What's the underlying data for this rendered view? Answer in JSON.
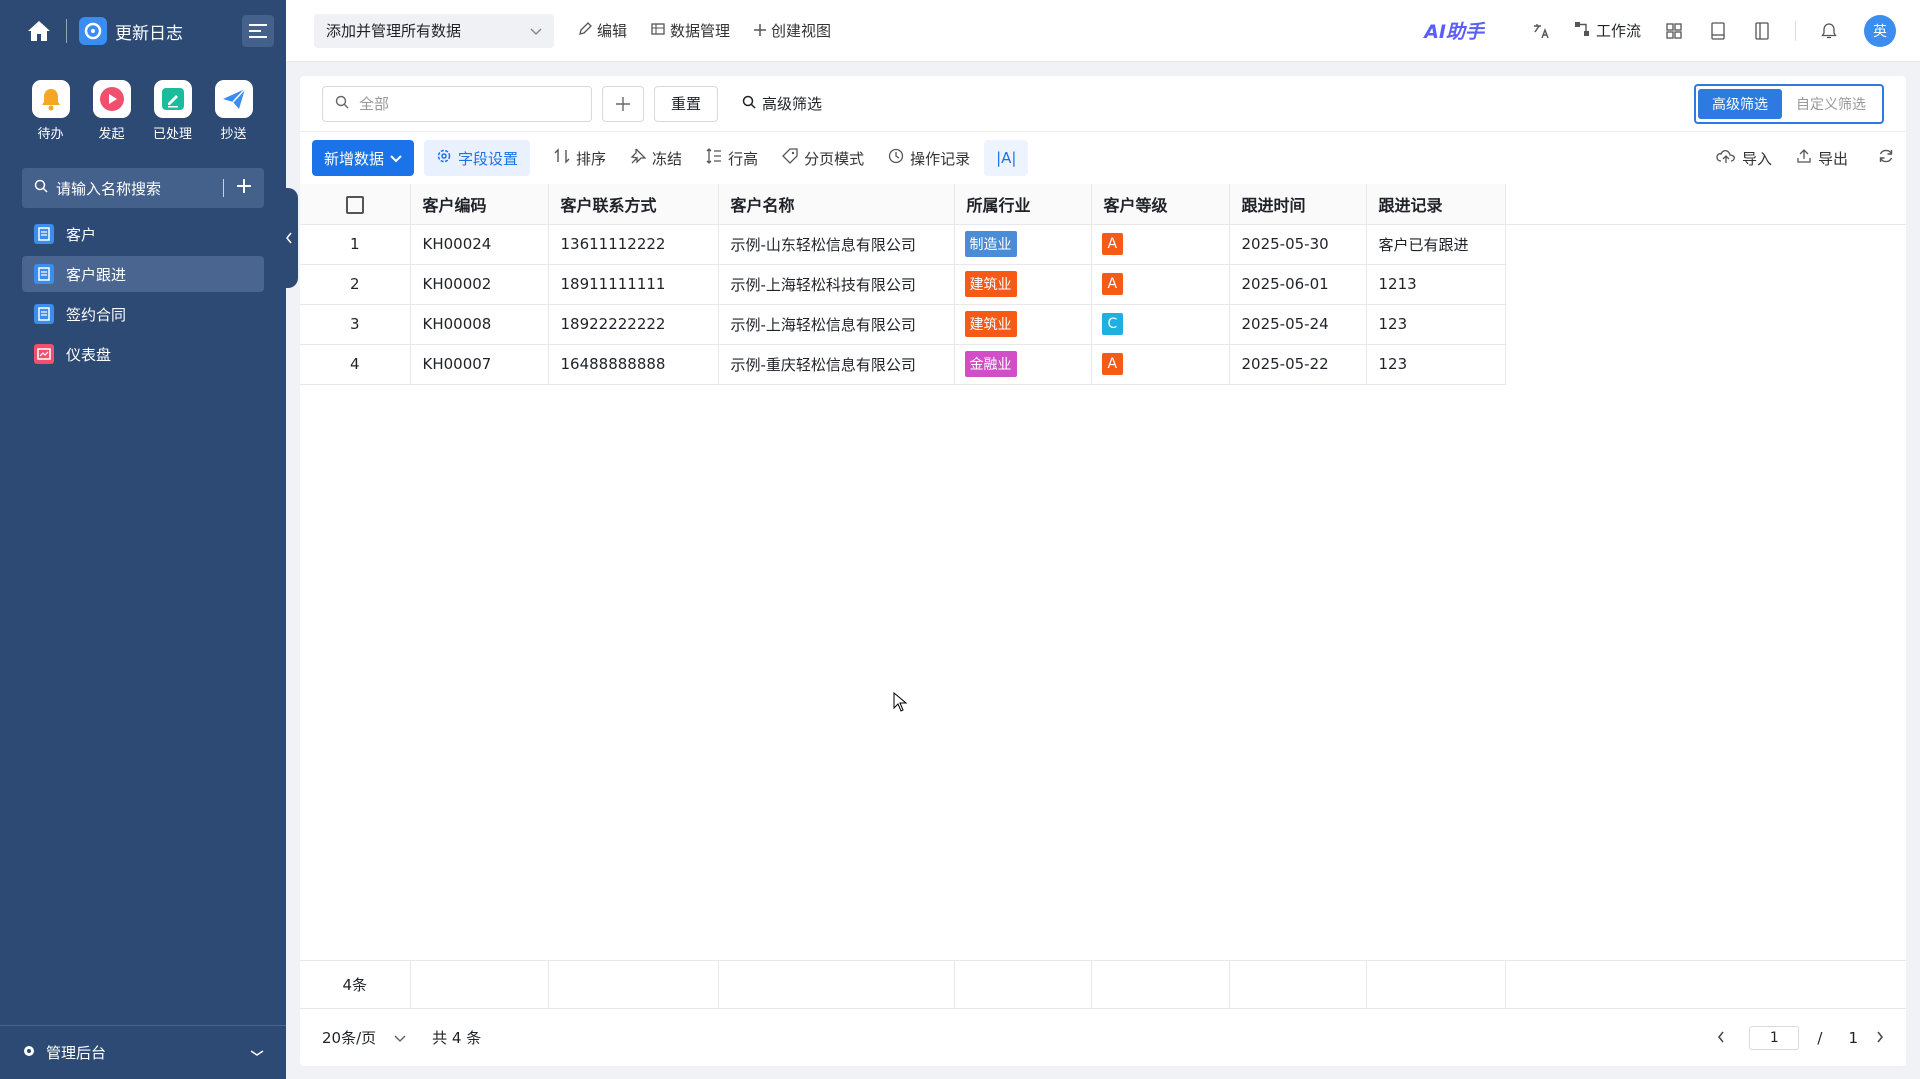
{
  "app": {
    "name": "更新日志"
  },
  "quick": [
    {
      "label": "待办",
      "icon": "bell-icon",
      "color": "#f5a623"
    },
    {
      "label": "发起",
      "icon": "play-icon",
      "color": "#f0506e"
    },
    {
      "label": "已处理",
      "icon": "check-doc-icon",
      "color": "#1abc9c"
    },
    {
      "label": "抄送",
      "icon": "send-icon",
      "color": "#3b8df0"
    }
  ],
  "sidebar": {
    "search_placeholder": "请输入名称搜索",
    "items": [
      {
        "label": "客户",
        "active": false
      },
      {
        "label": "客户跟进",
        "active": true
      },
      {
        "label": "签约合同",
        "active": false
      },
      {
        "label": "仪表盘",
        "active": false
      }
    ],
    "bottom_label": "管理后台"
  },
  "topbar": {
    "view": "添加并管理所有数据",
    "edit": "编辑",
    "data_manage": "数据管理",
    "create_view": "创建视图",
    "ai": "AI助手",
    "workflow": "工作流",
    "avatar": "英"
  },
  "filter": {
    "search_placeholder": "全部",
    "reset": "重置",
    "advanced": "高级筛选",
    "seg_on": "高级筛选",
    "seg_off": "自定义筛选"
  },
  "toolbar": {
    "add": "新增数据",
    "fields": "字段设置",
    "sort": "排序",
    "freeze": "冻结",
    "row_height": "行高",
    "paging": "分页模式",
    "history": "操作记录",
    "aa": "|A|",
    "import": "导入",
    "export": "导出"
  },
  "table": {
    "headers": [
      "客户编码",
      "客户联系方式",
      "客户名称",
      "所属行业",
      "客户等级",
      "跟进时间",
      "跟进记录"
    ],
    "rows": [
      {
        "idx": "1",
        "code": "KH00024",
        "phone": "13611112222",
        "name": "示例-山东轻松信息有限公司",
        "industry": "制造业",
        "industry_cls": "mfg",
        "level": "A",
        "time": "2025-05-30",
        "record": "客户已有跟进"
      },
      {
        "idx": "2",
        "code": "KH00002",
        "phone": "18911111111",
        "name": "示例-上海轻松科技有限公司",
        "industry": "建筑业",
        "industry_cls": "cons",
        "level": "A",
        "time": "2025-06-01",
        "record": "1213"
      },
      {
        "idx": "3",
        "code": "KH00008",
        "phone": "18922222222",
        "name": "示例-上海轻松信息有限公司",
        "industry": "建筑业",
        "industry_cls": "cons",
        "level": "C",
        "time": "2025-05-24",
        "record": "123"
      },
      {
        "idx": "4",
        "code": "KH00007",
        "phone": "16488888888",
        "name": "示例-重庆轻松信息有限公司",
        "industry": "金融业",
        "industry_cls": "fin",
        "level": "A",
        "time": "2025-05-22",
        "record": "123"
      }
    ],
    "count_label": "4条"
  },
  "pager": {
    "page_size": "20条/页",
    "total": "共 4 条",
    "page": "1",
    "slash": "/",
    "pages": "1"
  }
}
